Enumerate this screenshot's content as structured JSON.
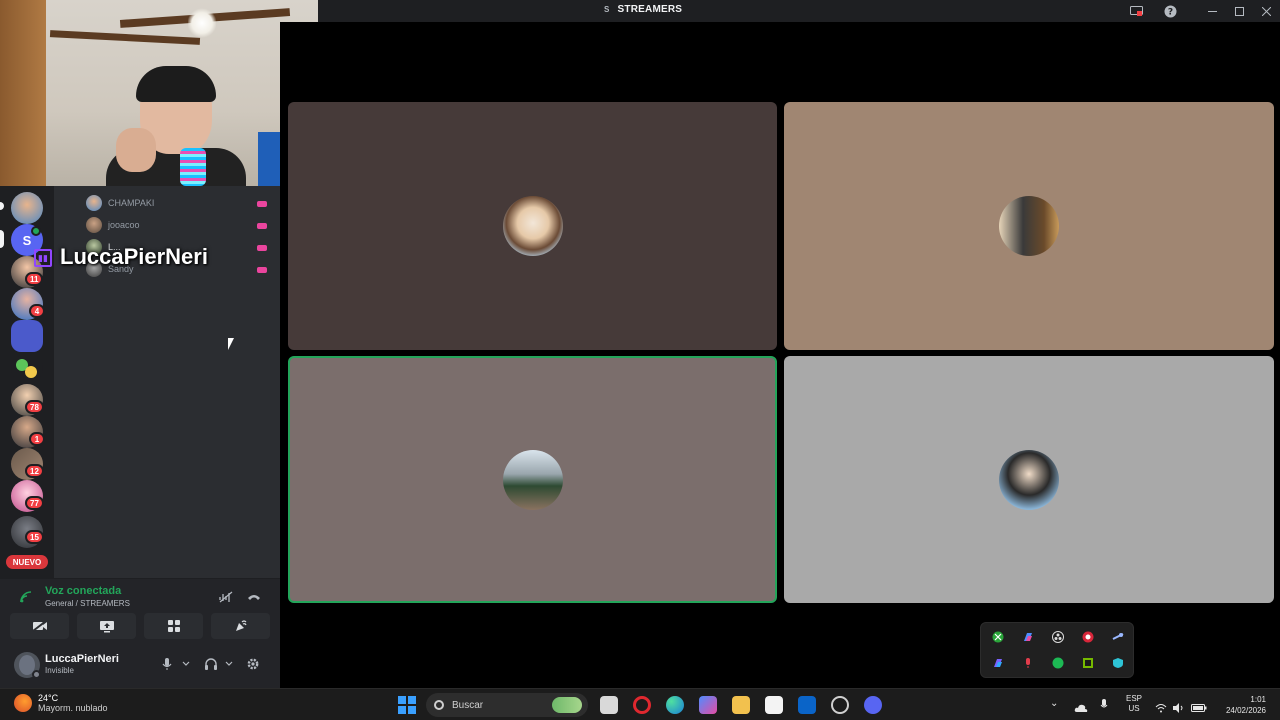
{
  "window": {
    "server_initial": "S",
    "channel_title": "STREAMERS"
  },
  "overlay": {
    "streamer_name": "LuccaPierNeri"
  },
  "servers": {
    "badges": [
      "11",
      "4",
      "78",
      "1",
      "12",
      "77",
      "15"
    ],
    "active_letter": "S",
    "new_label": "NUEVO"
  },
  "members": [
    {
      "name": "CHAMPAKI"
    },
    {
      "name": "jooacoo"
    },
    {
      "name": "L..."
    },
    {
      "name": "Sandy"
    }
  ],
  "voice": {
    "status": "Voz conectada",
    "location": "General / STREAMERS"
  },
  "user": {
    "name": "LuccaPierNeri",
    "status": "Invisible"
  },
  "taskbar": {
    "temp": "24°C",
    "weather": "Mayorm. nublado",
    "search_placeholder": "Buscar",
    "lang_top": "ESP",
    "lang_bottom": "US",
    "time": "1:01",
    "date": "24/02/2026"
  },
  "colors": {
    "tile_1": "#463a39",
    "tile_2": "#a08672",
    "tile_3": "#7b6e6c",
    "tile_4": "#a9a9a9",
    "speaking": "#23a55a",
    "voice_connected": "#23a55a",
    "badge": "#f23f43",
    "live": "#eb459e"
  },
  "icons": {
    "titlebar": [
      "screen-share-icon",
      "help-icon",
      "minimize-icon",
      "maximize-icon",
      "close-icon"
    ],
    "voice_panel": [
      "signal-icon",
      "noise-suppression-icon",
      "disconnect-icon",
      "camera-off-icon",
      "share-screen-icon",
      "activities-icon",
      "soundboard-icon"
    ],
    "user_panel": [
      "mic-icon",
      "chevron-down-icon",
      "headset-icon",
      "settings-icon"
    ]
  }
}
